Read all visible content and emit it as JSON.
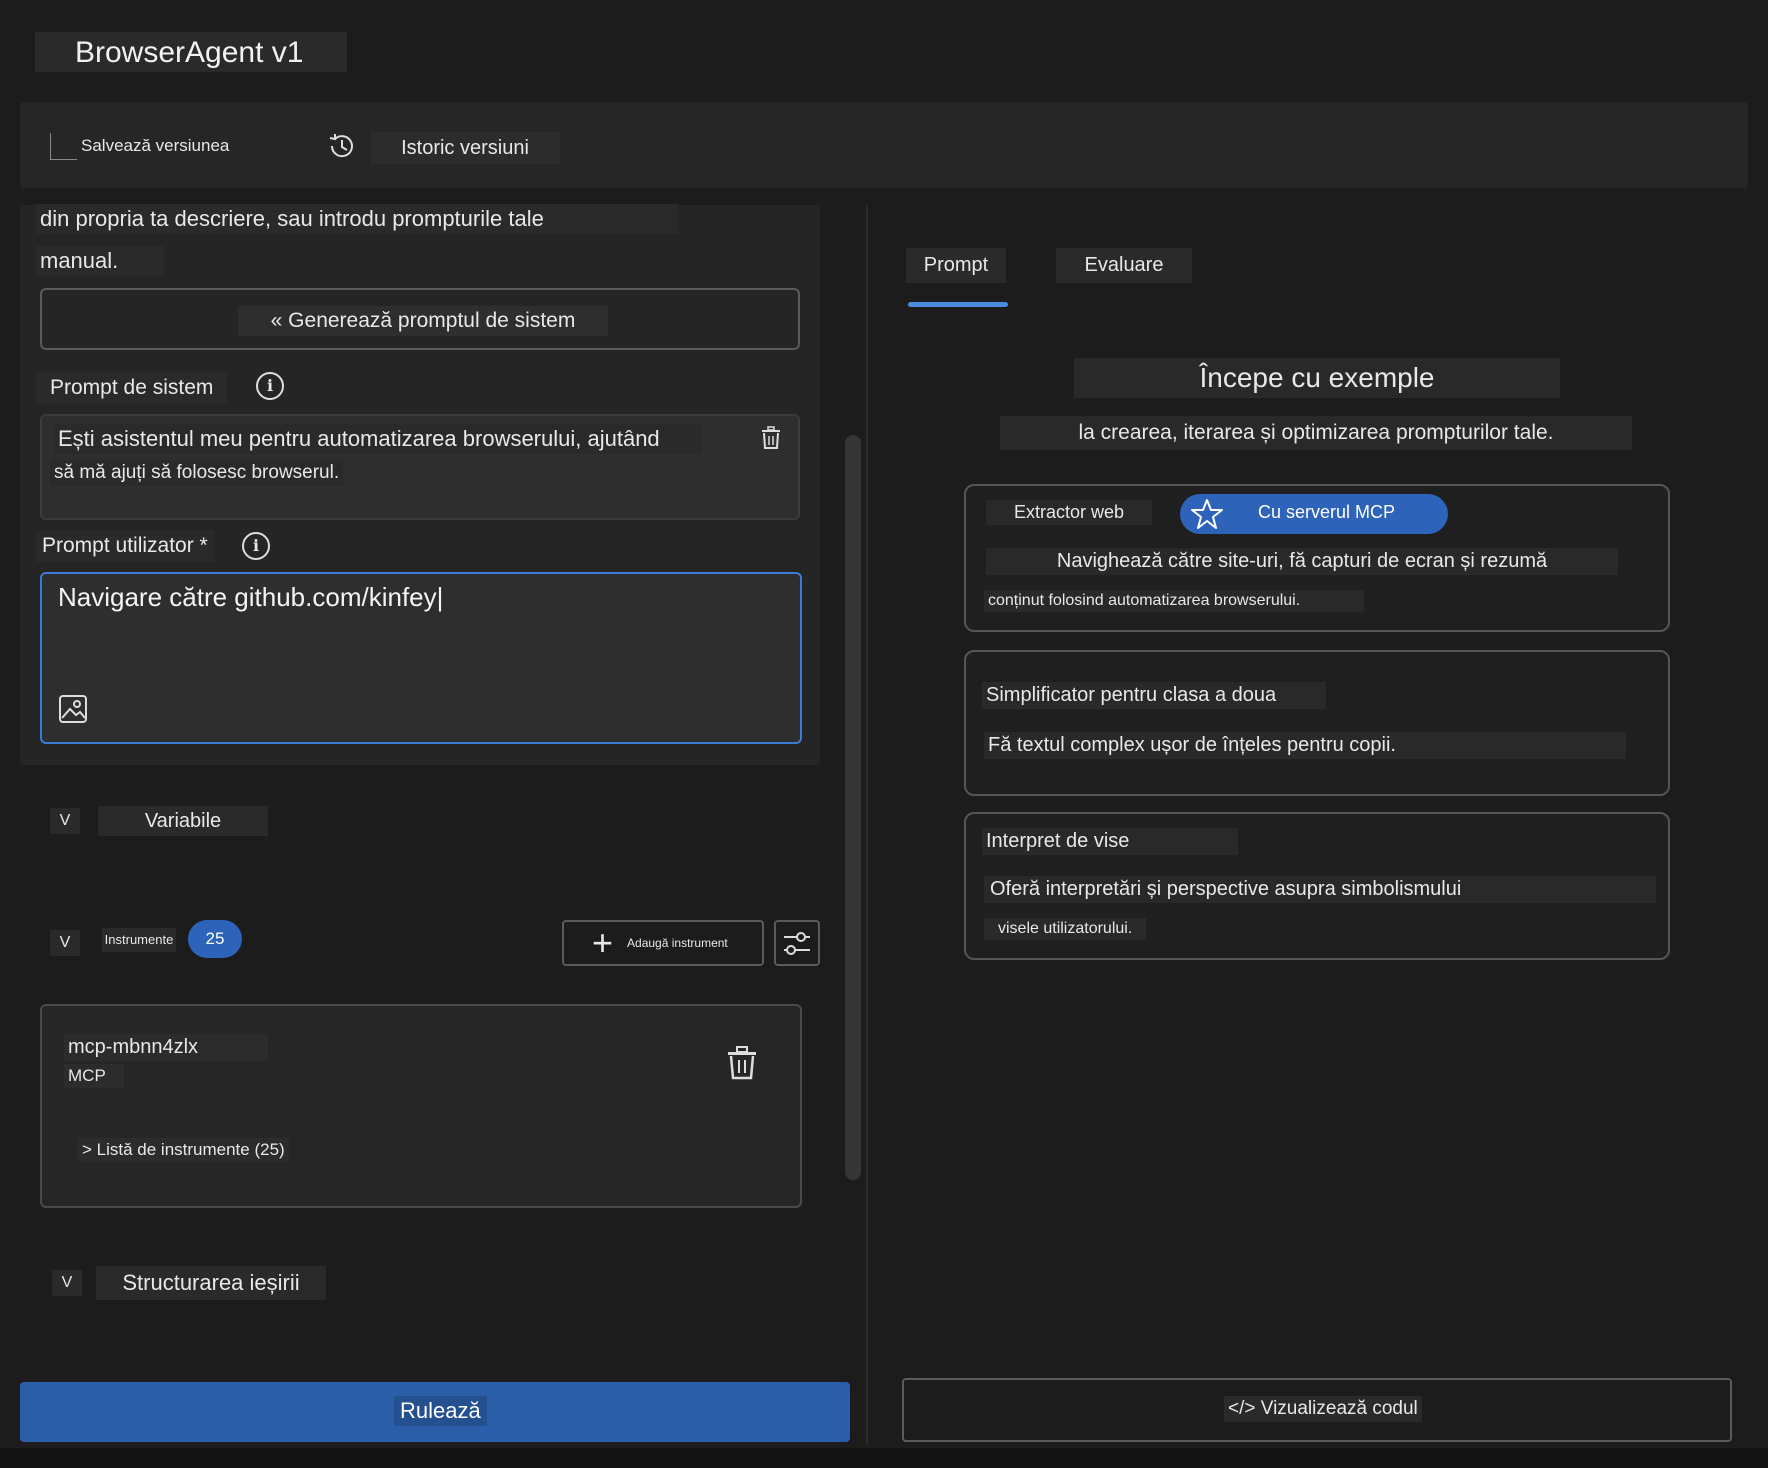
{
  "app": {
    "title": "BrowserAgent v1"
  },
  "toolbar": {
    "save_label": "Salvează versiunea",
    "history_label": "Istoric versiuni"
  },
  "left": {
    "intro_line1": "din propria ta descriere, sau introdu prompturile tale",
    "intro_line2": "manual.",
    "generate_button": "« Generează promptul de sistem",
    "system_prompt": {
      "label": "Prompt de sistem",
      "text_line1": "Ești asistentul meu pentru automatizarea browserului, ajutând",
      "text_line2": "să mă ajuți să folosesc browserul."
    },
    "user_prompt": {
      "label": "Prompt utilizator *",
      "value": "Navigare către github.com/kinfey|"
    },
    "variables": {
      "chevron": "V",
      "label": "Variabile"
    },
    "tools": {
      "chevron": "V",
      "label": "Instrumente",
      "count": "25",
      "add_button": "Adaugă instrument",
      "card": {
        "name": "mcp-mbnn4zlx",
        "type": "MCP",
        "list_label": "> Listă de instrumente (25)"
      }
    },
    "output": {
      "chevron": "V",
      "label": "Structurarea ieșirii"
    },
    "run_button": "Rulează"
  },
  "right": {
    "tabs": [
      {
        "label": "Prompt",
        "active": true
      },
      {
        "label": "Evaluare",
        "active": false
      }
    ],
    "examples_title": "Începe cu exemple",
    "examples_subtitle": "la crearea, iterarea și optimizarea prompturilor tale.",
    "cards": [
      {
        "title": "Extractor web",
        "badge": "Cu serverul MCP",
        "desc_line1": "Navighează către site-uri, fă capturi de ecran și rezumă",
        "desc_line2": "conținut folosind automatizarea browserului."
      },
      {
        "title": "Simplificator pentru clasa a doua",
        "desc_line1": "Fă textul complex ușor de înțeles pentru copii."
      },
      {
        "title": "Interpret de vise",
        "desc_line1": "Oferă interpretări și perspective asupra simbolismului",
        "desc_line2": "visele utilizatorului."
      }
    ],
    "code_button": "</> Vizualizează codul"
  },
  "colors": {
    "accent": "#2d63b8",
    "focus_border": "#3a7bd5",
    "background": "#1c1c1c",
    "panel": "#252525"
  },
  "icons": [
    "history-icon",
    "info-icon",
    "trash-icon",
    "image-icon",
    "plus-icon",
    "settings-sliders-icon",
    "star-icon"
  ]
}
